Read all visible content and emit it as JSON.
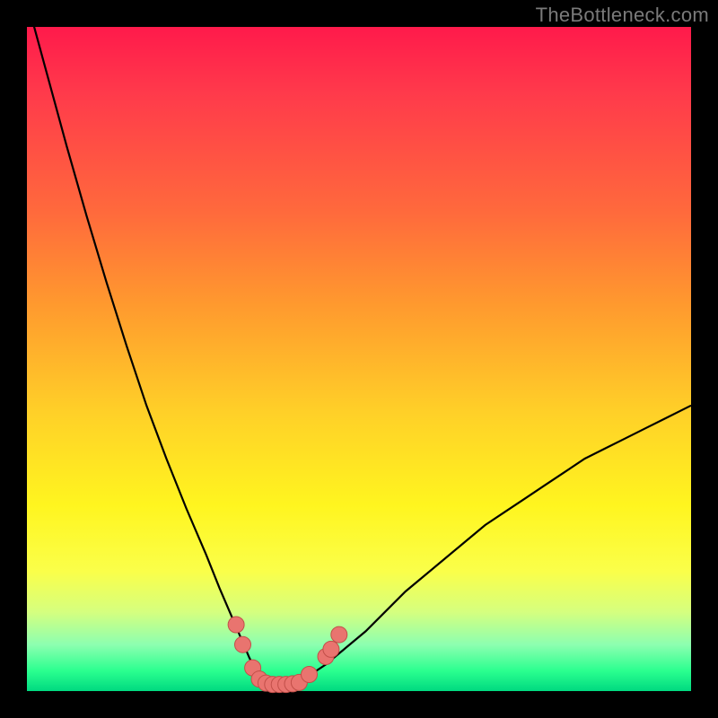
{
  "watermark": "TheBottleneck.com",
  "colors": {
    "curve": "#000000",
    "markers_fill": "#e9746f",
    "markers_stroke": "#c24f49"
  },
  "chart_data": {
    "type": "line",
    "title": "",
    "xlabel": "",
    "ylabel": "",
    "xlim": [
      0,
      100
    ],
    "ylim": [
      0,
      100
    ],
    "x": [
      0,
      3,
      6,
      9,
      12,
      15,
      18,
      21,
      24,
      27,
      29,
      30.5,
      32,
      33.5,
      34.5,
      36,
      37.5,
      39.5,
      42,
      45,
      48,
      51,
      54,
      57,
      60,
      63,
      66,
      69,
      72,
      75,
      78,
      81,
      84,
      87,
      90,
      93,
      96,
      100
    ],
    "y": [
      104,
      93,
      82,
      71.5,
      61.5,
      52,
      43,
      35,
      27.5,
      20.5,
      15.5,
      12,
      8.5,
      5,
      3,
      1.5,
      1,
      1,
      2,
      4,
      6.5,
      9,
      12,
      15,
      17.5,
      20,
      22.5,
      25,
      27,
      29,
      31,
      33,
      35,
      36.5,
      38,
      39.5,
      41,
      43
    ],
    "series": [
      {
        "name": "bottleneck_curve",
        "x_ref": "x",
        "y_ref": "y"
      }
    ],
    "markers": [
      {
        "x": 31.5,
        "y": 10
      },
      {
        "x": 32.5,
        "y": 7
      },
      {
        "x": 34,
        "y": 3.5
      },
      {
        "x": 35,
        "y": 1.8
      },
      {
        "x": 36,
        "y": 1.2
      },
      {
        "x": 37,
        "y": 1.0
      },
      {
        "x": 38,
        "y": 1.0
      },
      {
        "x": 39,
        "y": 1.0
      },
      {
        "x": 40,
        "y": 1.1
      },
      {
        "x": 41,
        "y": 1.3
      },
      {
        "x": 42.5,
        "y": 2.5
      },
      {
        "x": 45,
        "y": 5.2
      },
      {
        "x": 45.8,
        "y": 6.3
      },
      {
        "x": 47,
        "y": 8.5
      }
    ]
  }
}
